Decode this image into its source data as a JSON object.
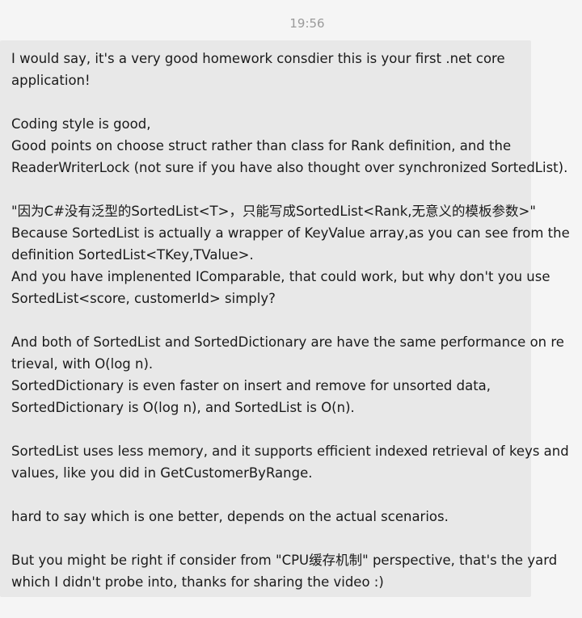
{
  "chat": {
    "timestamp": "19:56",
    "message_lines": [
      "I would say, it's a very good homework consdier this is your first .net core",
      "application!",
      "",
      "Coding style is good,",
      "Good points on choose struct rather than class for Rank definition, and the",
      "ReaderWriterLock (not sure if you have also thought over synchronized SortedList).",
      "",
      "\"因为C#没有泛型的SortedList<T>，只能写成SortedList<Rank,无意义的模板参数>\"",
      "Because SortedList is actually a wrapper of KeyValue array,as you can see from the",
      "definition SortedList<TKey,TValue>.",
      "And you have implenented IComparable, that could work, but why don't you use",
      "SortedList<score, customerId> simply?",
      "",
      "And both of SortedList and SortedDictionary are have the same performance on re",
      "trieval, with O(log n).",
      "SortedDictionary is even faster on insert and remove for unsorted data,",
      "SortedDictionary is O(log n), and SortedList is O(n).",
      "",
      "SortedList uses less memory, and it supports efficient indexed retrieval of keys and",
      "values, like you did in GetCustomerByRange.",
      "",
      "hard to say which is one better, depends on the actual scenarios.",
      "",
      "But you might be right if consider from \"CPU缓存机制\" perspective, that's the yard",
      "which I didn't probe into, thanks for sharing the video :)"
    ]
  }
}
